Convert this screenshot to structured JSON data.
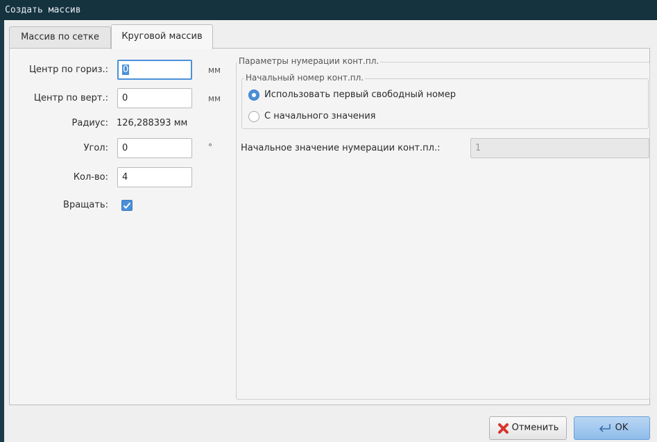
{
  "window": {
    "title": "Создать массив"
  },
  "tabs": [
    {
      "label": "Массив по сетке",
      "active": false
    },
    {
      "label": "Круговой массив",
      "active": true
    }
  ],
  "circular": {
    "center_x": {
      "label": "Центр по гориз.:",
      "value": "0",
      "unit": "мм"
    },
    "center_y": {
      "label": "Центр по верт.:",
      "value": "0",
      "unit": "мм"
    },
    "radius": {
      "label": "Радиус:",
      "value": "126,288393 мм"
    },
    "angle": {
      "label": "Угол:",
      "value": "0",
      "unit": "°"
    },
    "count": {
      "label": "Кол-во:",
      "value": "4"
    },
    "rotate": {
      "label": "Вращать:",
      "checked": true
    }
  },
  "numbering": {
    "group_title": "Параметры нумерации конт.пл.",
    "start_group_title": "Начальный номер конт.пл.",
    "option_first_free": "Использовать первый свободный номер",
    "option_from_start": "С начального значения",
    "selected": "option_first_free",
    "start_value_label": "Начальное значение нумерации конт.пл.:",
    "start_value": "1"
  },
  "buttons": {
    "cancel": "Отменить",
    "ok": "OK"
  },
  "colors": {
    "accent": "#4a90d9",
    "titlebar": "#15323f",
    "cancel_icon": "#d9342b"
  }
}
